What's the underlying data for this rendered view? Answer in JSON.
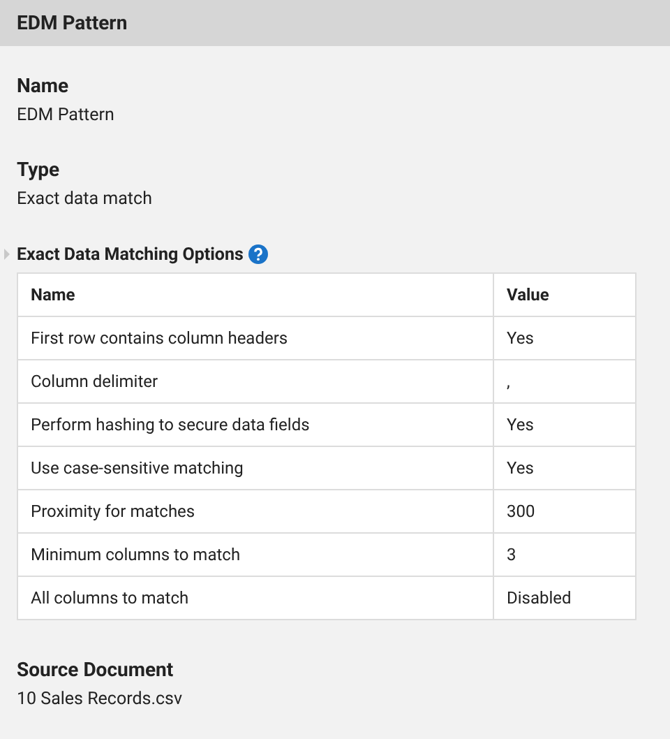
{
  "header": {
    "title": "EDM Pattern"
  },
  "fields": [
    {
      "label": "Name",
      "value": "EDM Pattern"
    },
    {
      "label": "Type",
      "value": "Exact data match"
    }
  ],
  "options": {
    "title": "Exact Data Matching Options",
    "columns": [
      "Name",
      "Value"
    ],
    "rows": [
      [
        "First row contains column headers",
        "Yes"
      ],
      [
        "Column delimiter",
        ","
      ],
      [
        "Perform hashing to secure data fields",
        "Yes"
      ],
      [
        "Use case-sensitive matching",
        "Yes"
      ],
      [
        "Proximity for matches",
        "300"
      ],
      [
        "Minimum columns to match",
        "3"
      ],
      [
        "All columns to match",
        "Disabled"
      ]
    ]
  },
  "source": {
    "label": "Source Document",
    "value": "10 Sales Records.csv"
  }
}
